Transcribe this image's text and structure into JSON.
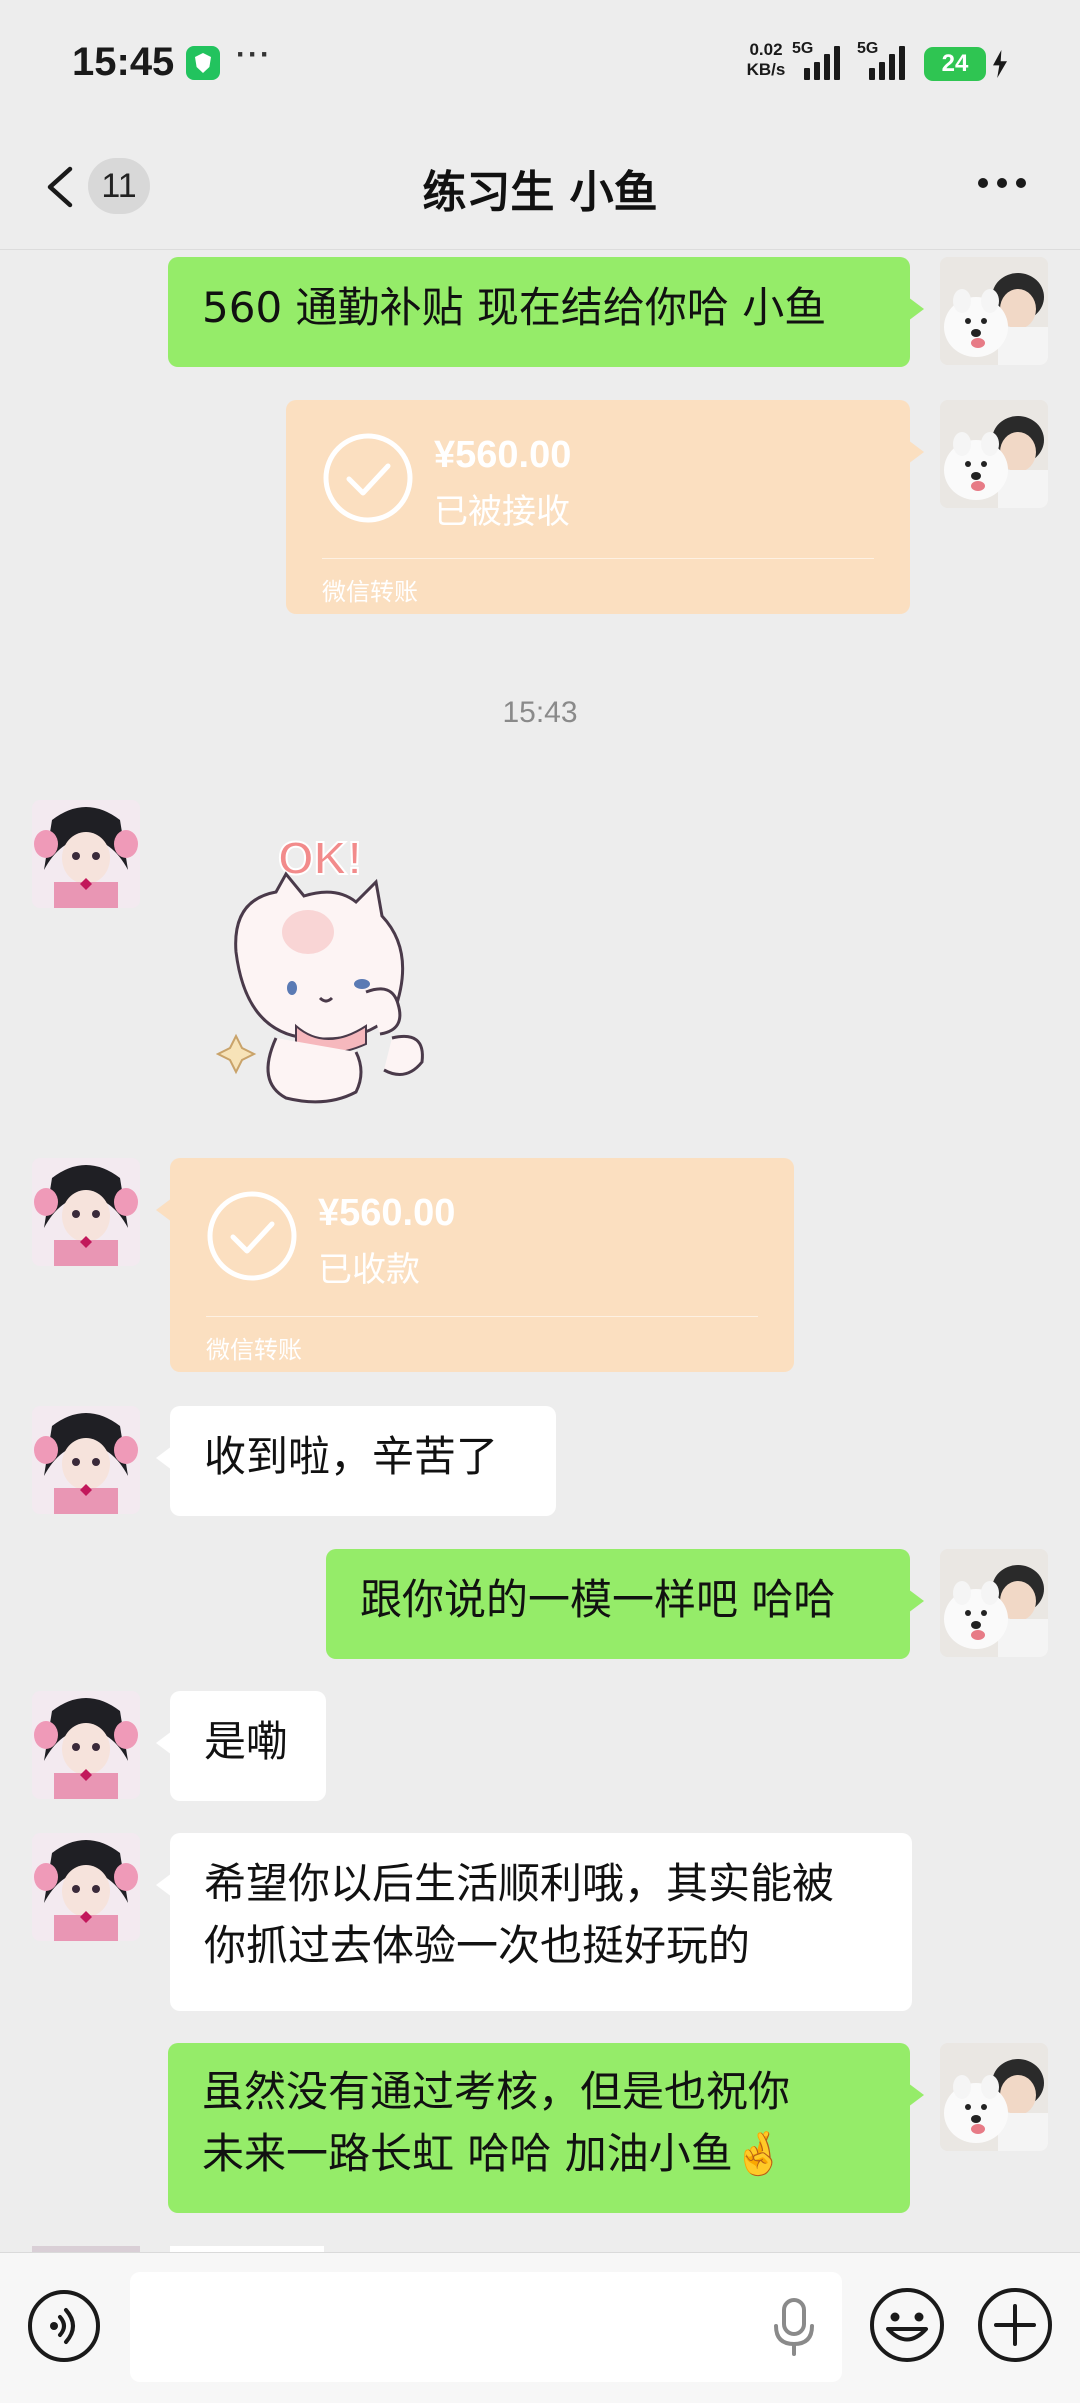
{
  "status_bar": {
    "time": "15:45",
    "more": "···",
    "net_speed_value": "0.02",
    "net_speed_unit": "KB/s",
    "signal_1_label": "5G",
    "signal_2_label": "5G",
    "battery": "24",
    "shield_icon": "shield-check-icon",
    "charging_icon": "bolt-icon"
  },
  "header": {
    "back_icon": "chevron-left-icon",
    "unread_count": "11",
    "title": "练习生 小鱼",
    "more_icon": "more-horizontal-icon"
  },
  "messages": [
    {
      "from": "self",
      "type": "text",
      "text": "560 通勤补贴 现在结给你哈 小鱼"
    },
    {
      "from": "self",
      "type": "transfer",
      "amount": "¥560.00",
      "status": "已被接收",
      "footer": "微信转账"
    },
    {
      "type": "timestamp",
      "text": "15:43"
    },
    {
      "from": "other",
      "type": "sticker",
      "sticker_text": "OK!"
    },
    {
      "from": "other",
      "type": "transfer",
      "amount": "¥560.00",
      "status": "已收款",
      "footer": "微信转账"
    },
    {
      "from": "other",
      "type": "text",
      "text": "收到啦，辛苦了"
    },
    {
      "from": "self",
      "type": "text",
      "text": "跟你说的一模一样吧 哈哈"
    },
    {
      "from": "other",
      "type": "text",
      "text": "是嘞"
    },
    {
      "from": "other",
      "type": "text",
      "lines": [
        "希望你以后生活顺利哦，其实能被",
        "你抓过去体验一次也挺好玩的"
      ]
    },
    {
      "from": "self",
      "type": "text",
      "lines": [
        "虽然没有通过考核，但是也祝你",
        "未来一路长虹 哈哈 加油小鱼"
      ],
      "emoji": "🤞"
    }
  ],
  "input_bar": {
    "voice_icon": "voice-icon",
    "input_value": "",
    "mic_icon": "microphone-icon",
    "emoji_icon": "emoji-icon",
    "plus_icon": "plus-circle-icon"
  },
  "colors": {
    "background": "#ededed",
    "self_bubble": "#95ec69",
    "other_bubble": "#ffffff",
    "transfer_card": "#fbdfc0",
    "battery": "#2fc552"
  }
}
